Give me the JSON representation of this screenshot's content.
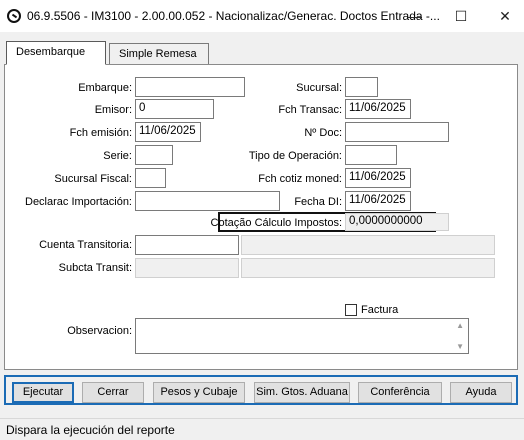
{
  "window": {
    "title": "06.9.5506 - IM3100 - 2.00.00.052 - Nacionalizac/Generac. Doctos Entrada -...",
    "minimize": "—",
    "maximize": "☐",
    "close": "✕"
  },
  "tabs": [
    {
      "label": "Desembarque",
      "active": true
    },
    {
      "label": "Simple Remesa",
      "active": false
    }
  ],
  "form": {
    "embarque": {
      "label": "Embarque:",
      "value": ""
    },
    "sucursal": {
      "label": "Sucursal:",
      "value": ""
    },
    "emisor": {
      "label": "Emisor:",
      "value": "0"
    },
    "fch_transac": {
      "label": "Fch Transac:",
      "value": "11/06/2025"
    },
    "fch_emision": {
      "label": "Fch emisión:",
      "value": "11/06/2025"
    },
    "no_doc": {
      "label": "Nº Doc:",
      "value": ""
    },
    "serie": {
      "label": "Serie:",
      "value": ""
    },
    "tipo_operacion": {
      "label": "Tipo de Operación:",
      "value": ""
    },
    "sucursal_fiscal": {
      "label": "Sucursal Fiscal:",
      "value": ""
    },
    "fch_cotiz": {
      "label": "Fch cotiz moned:",
      "value": "11/06/2025"
    },
    "declarac": {
      "label": "Declarac Importación:",
      "value": ""
    },
    "fecha_di": {
      "label": "Fecha DI:",
      "value": "11/06/2025"
    },
    "cotacao": {
      "label": "Cotação Cálculo Impostos:",
      "value": "0,0000000000"
    },
    "cuenta_transitoria": {
      "label": "Cuenta Transitoria:",
      "value": ""
    },
    "subcta_transit": {
      "label": "Subcta Transit:",
      "value": ""
    },
    "factura": {
      "label": "Factura",
      "checked": false
    },
    "observacion": {
      "label": "Observacion:",
      "value": ""
    }
  },
  "buttons": {
    "ejecutar": "Ejecutar",
    "cerrar": "Cerrar",
    "pesos": "Pesos y Cubaje",
    "sim": "Sim. Gtos. Aduana",
    "conferencia": "Conferência",
    "ayuda": "Ayuda"
  },
  "status": "Dispara la ejecución del reporte"
}
